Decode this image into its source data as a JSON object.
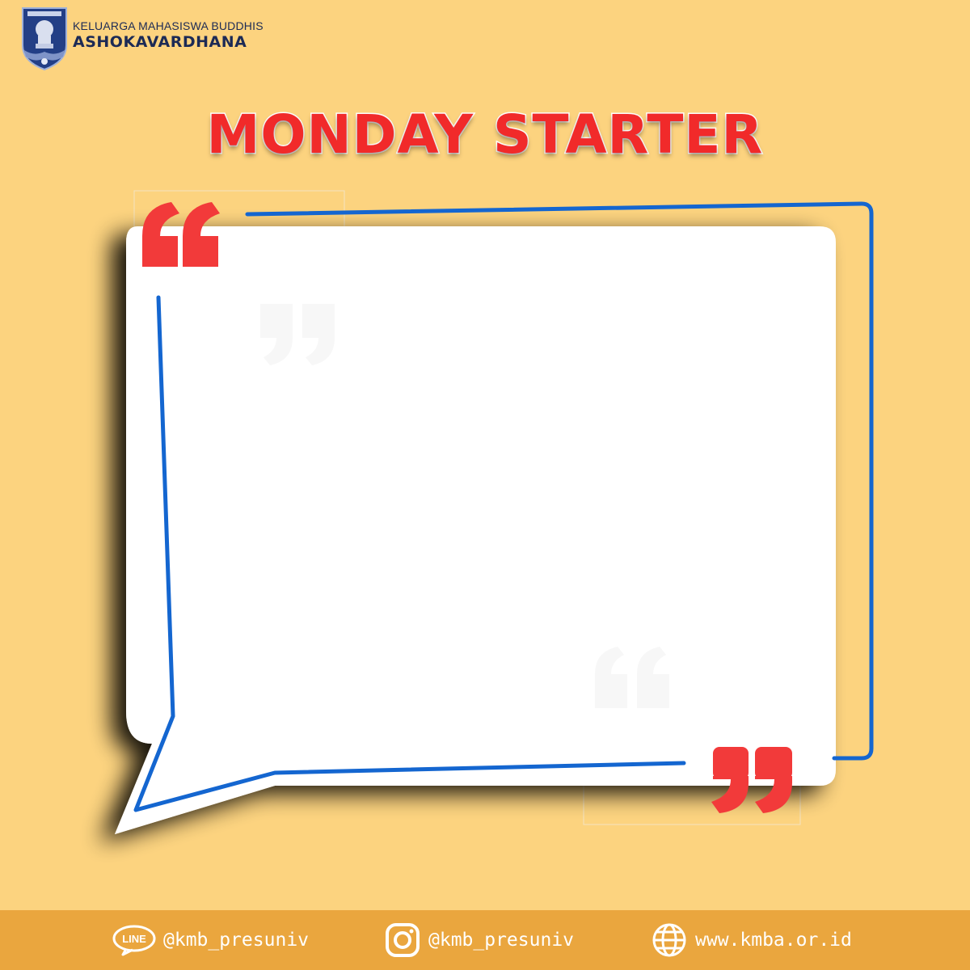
{
  "header": {
    "org_line": "KELUARGA MAHASISWA BUDDHIS",
    "org_name": "ASHOKAVARDHANA",
    "logo_icon": "ashoka-emblem-icon"
  },
  "title": "MONDAY STARTER",
  "colors": {
    "background": "#fcd37f",
    "footer": "#eaa63e",
    "title": "#f12a2a",
    "frame_line": "#1466d0",
    "quote_mark": "#f23a3a"
  },
  "footer": {
    "line": {
      "icon": "line-app-icon",
      "label": "@kmb_presuniv"
    },
    "instagram": {
      "icon": "instagram-icon",
      "label": "@kmb_presuniv"
    },
    "website": {
      "icon": "globe-icon",
      "label": "www.kmba.or.id"
    }
  }
}
